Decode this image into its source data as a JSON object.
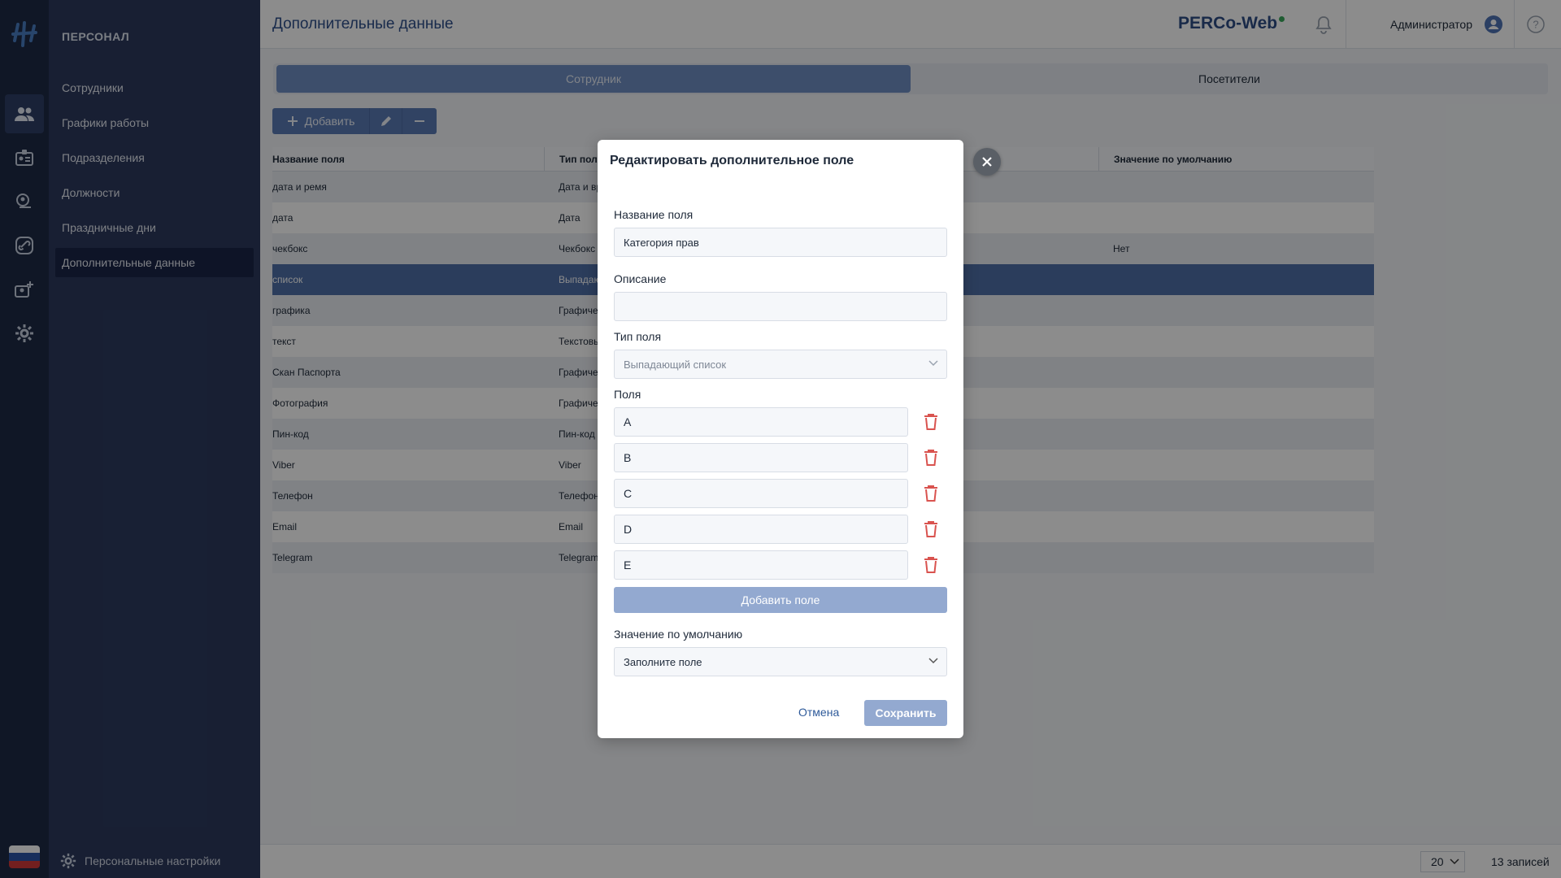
{
  "sidebar": {
    "section_title": "ПЕРСОНАЛ",
    "items": [
      {
        "label": "Сотрудники"
      },
      {
        "label": "Графики работы"
      },
      {
        "label": "Подразделения"
      },
      {
        "label": "Должности"
      },
      {
        "label": "Праздничные дни"
      },
      {
        "label": "Дополнительные данные"
      }
    ],
    "active_index": 5,
    "footer_label": "Персональные настройки"
  },
  "rail": {
    "icons": [
      "people-icon",
      "id-card-icon",
      "location-person-icon",
      "link-icon",
      "person-add-icon",
      "gear-icon"
    ],
    "active_index": 0
  },
  "header": {
    "title": "Дополнительные данные",
    "brand": "PERCo-Web",
    "user": "Администратор"
  },
  "tabs": [
    {
      "label": "Сотрудник",
      "active": true
    },
    {
      "label": "Посетители",
      "active": false
    }
  ],
  "toolbar": {
    "add_label": "Добавить"
  },
  "table": {
    "columns": [
      "Название поля",
      "Тип поля",
      "",
      "Значение по умолчанию"
    ],
    "rows": [
      {
        "name": "дата и ремя",
        "type": "Дата и вре",
        "default": ""
      },
      {
        "name": "дата",
        "type": "Дата",
        "default": ""
      },
      {
        "name": "чекбокс",
        "type": "Чекбокс",
        "default": "Нет"
      },
      {
        "name": "список",
        "type": "Выпадающ",
        "default": "",
        "selected": true
      },
      {
        "name": "графика",
        "type": "Графическ",
        "default": ""
      },
      {
        "name": "текст",
        "type": "Текстовый",
        "default": ""
      },
      {
        "name": "Скан Паспорта",
        "type": "Графическ",
        "default": ""
      },
      {
        "name": "Фотография",
        "type": "Графическ",
        "default": ""
      },
      {
        "name": "Пин-код",
        "type": "Пин-код",
        "default": ""
      },
      {
        "name": "Viber",
        "type": "Viber",
        "default": ""
      },
      {
        "name": "Телефон",
        "type": "Телефон",
        "default": ""
      },
      {
        "name": "Email",
        "type": "Email",
        "default": ""
      },
      {
        "name": "Telegram",
        "type": "Telegram",
        "default": ""
      }
    ]
  },
  "pager": {
    "page_size": "20",
    "records": "13 записей"
  },
  "modal": {
    "title": "Редактировать дополнительное поле",
    "name_label": "Название поля",
    "name_value": "Категория прав",
    "description_label": "Описание",
    "description_value": "",
    "type_label": "Тип поля",
    "type_value": "Выпадающий список",
    "options_label": "Поля",
    "options": [
      "A",
      "B",
      "C",
      "D",
      "E"
    ],
    "add_field_label": "Добавить поле",
    "default_label": "Значение по умолчанию",
    "default_placeholder": "Заполните поле",
    "cancel_label": "Отмена",
    "save_label": "Сохранить"
  },
  "colors": {
    "rail_bg": "#1e2a45",
    "sidebar_bg": "#2c3a5e",
    "accent": "#5a7bb5",
    "selected_row": "#4f6fa8",
    "danger": "#d9534f"
  }
}
